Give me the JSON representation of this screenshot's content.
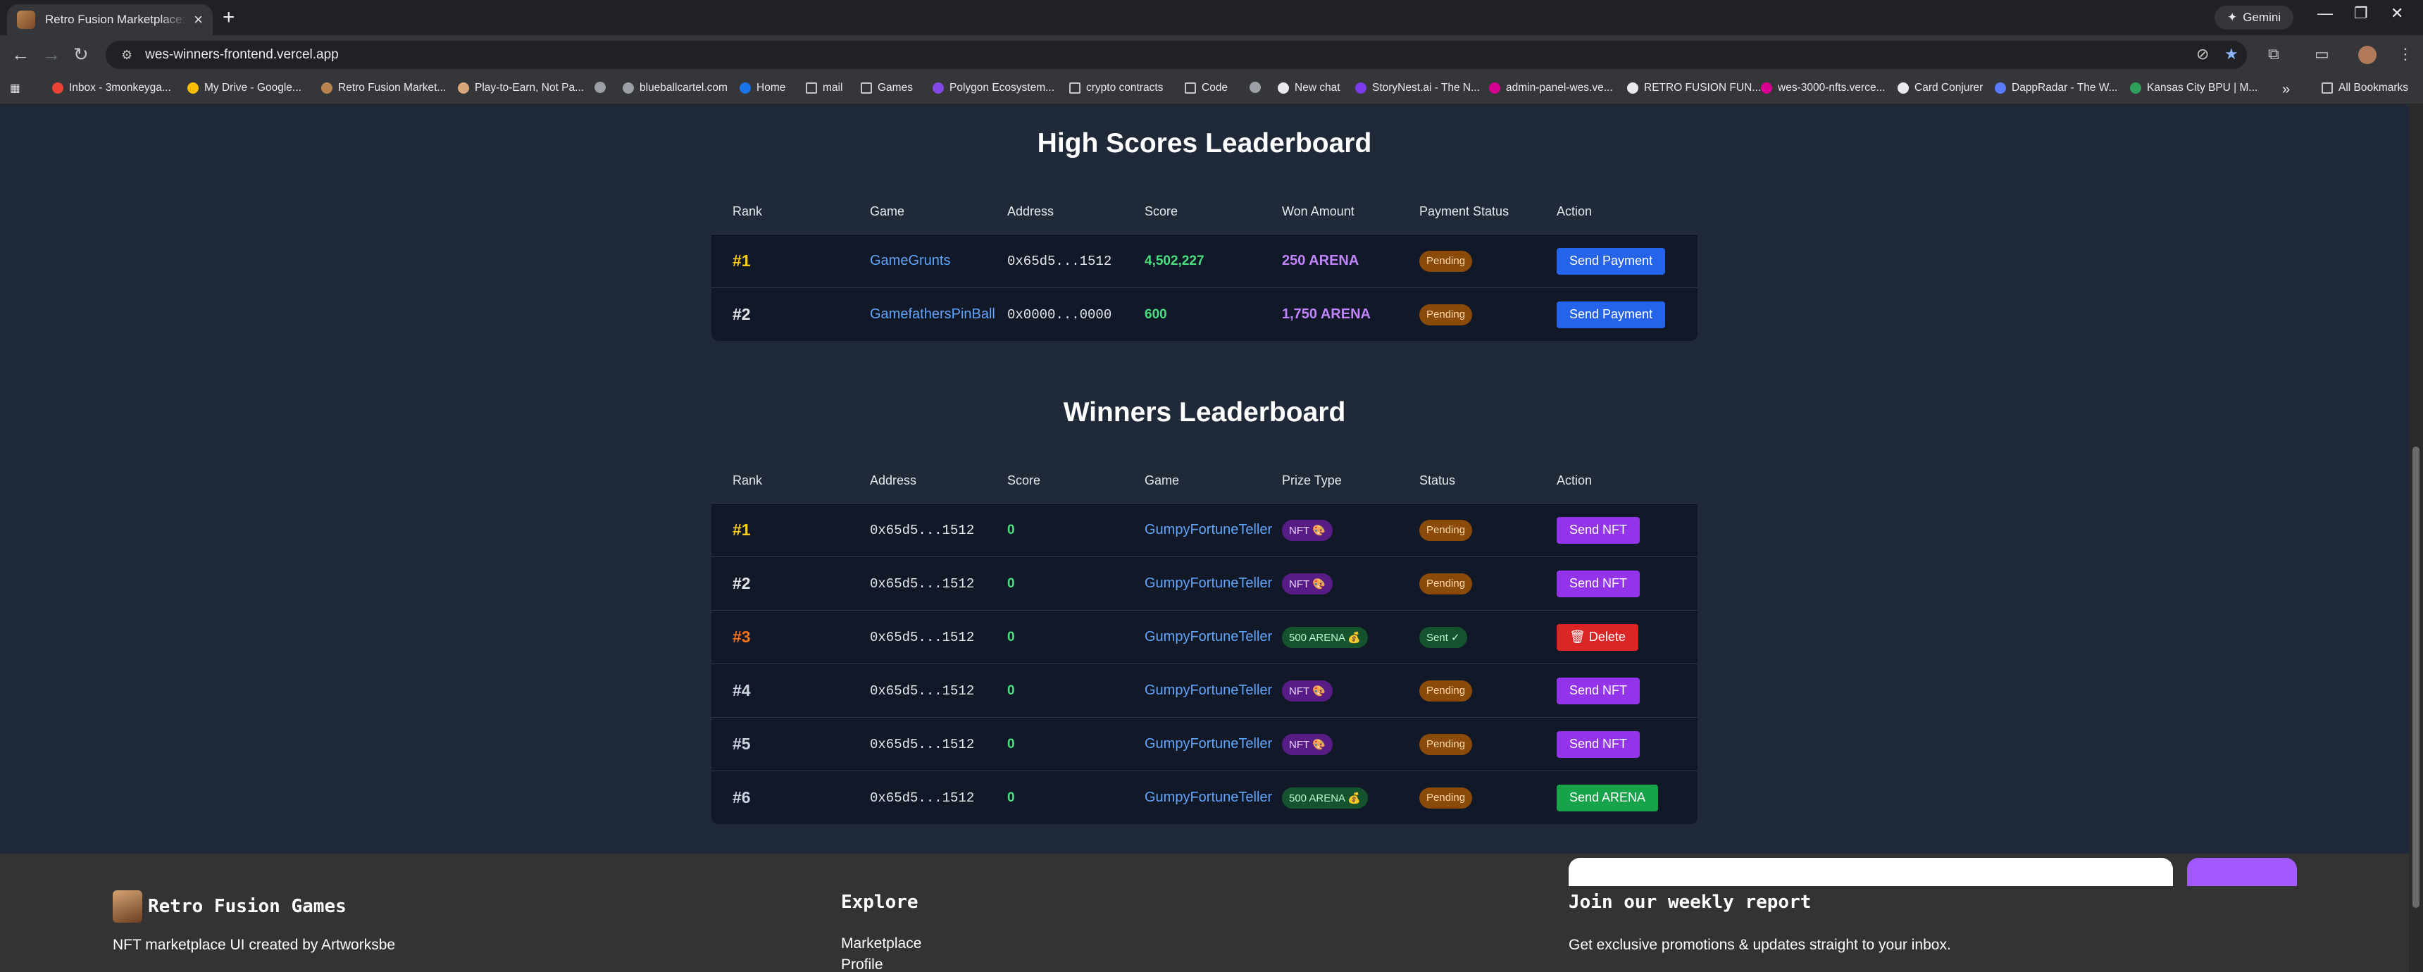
{
  "browser": {
    "tab_title": "Retro Fusion Marketplace: The NFT Marketplace",
    "new_tab": "+",
    "gemini_label": "Gemini",
    "url": "wes-winners-frontend.vercel.app",
    "bookmarks": [
      "Inbox - 3monkeyga...",
      "My Drive - Google...",
      "Retro Fusion Market...",
      "Play-to-Earn, Not Pa...",
      "",
      "blueballcartel.com",
      "Home",
      "mail",
      "Games",
      "Polygon Ecosystem...",
      "crypto contracts",
      "Code",
      "",
      "New chat",
      "StoryNest.ai - The N...",
      "admin-panel-wes.ve...",
      "RETRO FUSION FUN...",
      "wes-3000-nfts.verce...",
      "Card Conjurer",
      "DappRadar - The W...",
      "Kansas City BPU | M..."
    ],
    "all_bookmarks": "All Bookmarks"
  },
  "high_scores": {
    "title": "High Scores Leaderboard",
    "headers": [
      "Rank",
      "Game",
      "Address",
      "Score",
      "Won Amount",
      "Payment Status",
      "Action"
    ],
    "rows": [
      {
        "rank": "#1",
        "game": "GameGrunts",
        "address": "0x65d5...1512",
        "score": "4,502,227",
        "won": "250 ARENA",
        "status": "Pending",
        "action": "Send Payment"
      },
      {
        "rank": "#2",
        "game": "GamefathersPinBall",
        "address": "0x0000...0000",
        "score": "600",
        "won": "1,750 ARENA",
        "status": "Pending",
        "action": "Send Payment"
      }
    ]
  },
  "winners": {
    "title": "Winners Leaderboard",
    "headers": [
      "Rank",
      "Address",
      "Score",
      "Game",
      "Prize Type",
      "Status",
      "Action"
    ],
    "rows": [
      {
        "rank": "#1",
        "address": "0x65d5...1512",
        "score": "0",
        "game": "GumpyFortuneTeller",
        "prize": "NFT 🎨",
        "status": "Pending",
        "action": "Send NFT"
      },
      {
        "rank": "#2",
        "address": "0x65d5...1512",
        "score": "0",
        "game": "GumpyFortuneTeller",
        "prize": "NFT 🎨",
        "status": "Pending",
        "action": "Send NFT"
      },
      {
        "rank": "#3",
        "address": "0x65d5...1512",
        "score": "0",
        "game": "GumpyFortuneTeller",
        "prize": "500 ARENA 💰",
        "status": "Sent ✓",
        "action": "🗑 Delete"
      },
      {
        "rank": "#4",
        "address": "0x65d5...1512",
        "score": "0",
        "game": "GumpyFortuneTeller",
        "prize": "NFT 🎨",
        "status": "Pending",
        "action": "Send NFT"
      },
      {
        "rank": "#5",
        "address": "0x65d5...1512",
        "score": "0",
        "game": "GumpyFortuneTeller",
        "prize": "NFT 🎨",
        "status": "Pending",
        "action": "Send NFT"
      },
      {
        "rank": "#6",
        "address": "0x65d5...1512",
        "score": "0",
        "game": "GumpyFortuneTeller",
        "prize": "500 ARENA 💰",
        "status": "Pending",
        "action": "Send ARENA"
      }
    ]
  },
  "footer": {
    "brand": "Retro Fusion Games",
    "tagline": "NFT marketplace UI created by Artworksbe",
    "explore_heading": "Explore",
    "explore_links": [
      "Marketplace",
      "Profile"
    ],
    "newsletter_heading": "Join our weekly report",
    "newsletter_sub": "Get exclusive promotions & updates straight to your inbox."
  },
  "colors": {
    "page_bg": "#1f2937",
    "table_bg": "#111827",
    "rank_gold": "#facc15",
    "rank_bronze": "#f97316",
    "link_blue": "#60a5fa",
    "score_green": "#4ade80",
    "won_purple": "#c084fc",
    "btn_blue": "#2563eb",
    "btn_purple": "#9333ea",
    "btn_red": "#dc2626",
    "btn_green": "#16a34a"
  }
}
